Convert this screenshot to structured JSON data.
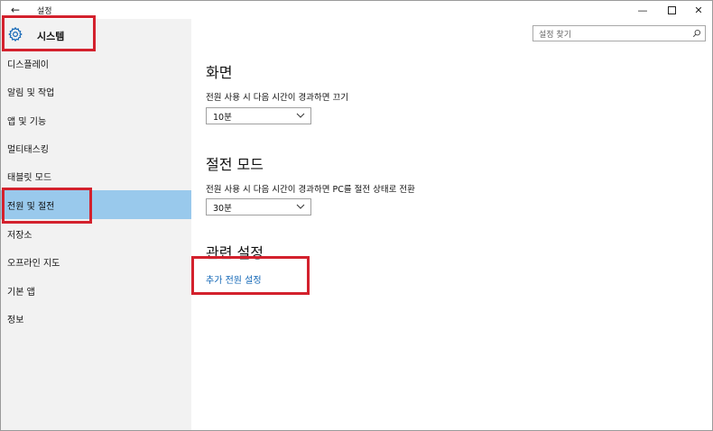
{
  "titlebar": {
    "back_glyph": "←",
    "title": "설정",
    "minimize_glyph": "—",
    "close_glyph": "✕"
  },
  "sidebar": {
    "header": {
      "icon": "gear-icon",
      "label": "시스템"
    },
    "items": [
      {
        "label": "디스플레이",
        "selected": false
      },
      {
        "label": "알림 및 작업",
        "selected": false
      },
      {
        "label": "앱 및 기능",
        "selected": false
      },
      {
        "label": "멀티태스킹",
        "selected": false
      },
      {
        "label": "태블릿 모드",
        "selected": false
      },
      {
        "label": "전원 및 절전",
        "selected": true
      },
      {
        "label": "저장소",
        "selected": false
      },
      {
        "label": "오프라인 지도",
        "selected": false
      },
      {
        "label": "기본 앱",
        "selected": false
      },
      {
        "label": "정보",
        "selected": false
      }
    ],
    "selected_color": "#99c9ec",
    "background_color": "#f2f2f2"
  },
  "search": {
    "placeholder": "설정 찾기",
    "icon": "search-icon"
  },
  "main": {
    "screen": {
      "heading": "화면",
      "description": "전원 사용 시 다음 시간이 경과하면 끄기",
      "dropdown_value": "10분"
    },
    "sleep": {
      "heading": "절전 모드",
      "description": "전원 사용 시 다음 시간이 경과하면 PC를 절전 상태로 전환",
      "dropdown_value": "30분"
    },
    "related": {
      "heading": "관련 설정",
      "link": "추가 전원 설정"
    }
  },
  "colors": {
    "link": "#1468b7",
    "annotation_red": "#d3212d"
  }
}
